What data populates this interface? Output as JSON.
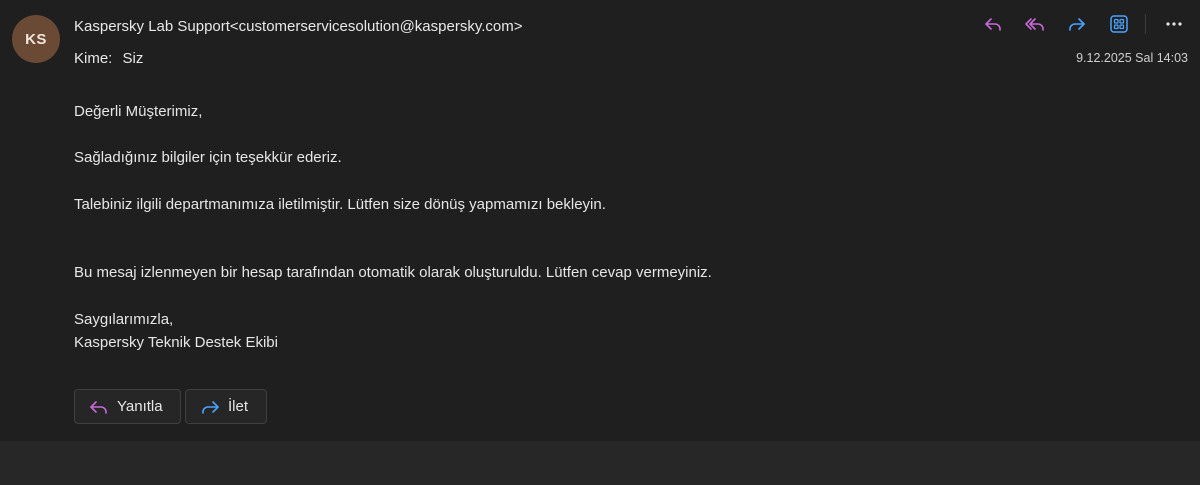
{
  "sender": {
    "initials": "KS",
    "display": "Kaspersky Lab Support<customerservicesolution@kaspersky.com>",
    "avatar_color": "#6a4a35"
  },
  "recipient": {
    "label": "Kime:",
    "value": "Siz"
  },
  "timestamp": "9.12.2025 Sal 14:03",
  "toolbar": {
    "icons": [
      "reply-icon",
      "reply-all-icon",
      "forward-icon",
      "apps-icon",
      "more-icon"
    ],
    "reply_color": "#c76ad6",
    "forward_color": "#4aa3ff"
  },
  "body": {
    "greeting": "Değerli Müşterimiz,",
    "thanks": "Sağladığınız bilgiler için teşekkür ederiz.",
    "forwarded": "Talebiniz ilgili departmanımıza iletilmiştir. Lütfen size dönüş yapmamızı bekleyin.",
    "auto_notice": "Bu mesaj izlenmeyen bir hesap tarafından otomatik olarak oluşturuldu. Lütfen cevap vermeyiniz.",
    "regards": "Saygılarımızla,",
    "team": "Kaspersky Teknik Destek Ekibi"
  },
  "actions": {
    "reply_label": "Yanıtla",
    "forward_label": "İlet"
  }
}
